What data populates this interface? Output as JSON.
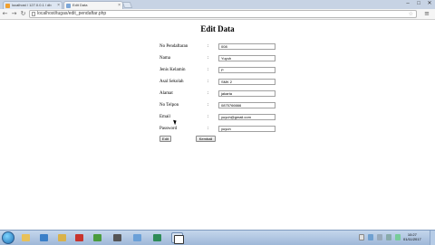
{
  "browser": {
    "tabs": [
      {
        "title": "localhost / 127.0.0.1 / db",
        "favicon": "#f0a030",
        "active": false
      },
      {
        "title": "Edit Data",
        "favicon": "#7da7d8",
        "active": true
      }
    ],
    "address": "localhost/tugas/edit_pendaftar.php",
    "window_controls": [
      "–",
      "□",
      "✕"
    ]
  },
  "page": {
    "title": "Edit Data",
    "fields": [
      {
        "label": "No Pendaftaran",
        "value": "008"
      },
      {
        "label": "Nama",
        "value": "Yuyuh"
      },
      {
        "label": "Jenis Kelamin",
        "value": "P"
      },
      {
        "label": "Asal Sekolah",
        "value": "SMK 2"
      },
      {
        "label": "Alamat",
        "value": "jakarta"
      },
      {
        "label": "No Telpon",
        "value": "0875766666"
      },
      {
        "label": "Email",
        "value": "yuyuh@gmail.com"
      },
      {
        "label": "Password",
        "value": "yuyuh"
      }
    ],
    "colon": ":",
    "buttons": {
      "submit": "Edit",
      "back": "Kembali"
    }
  },
  "taskbar": {
    "apps": [
      {
        "name": "explorer",
        "color": "#e8c15a"
      },
      {
        "name": "media-player",
        "color": "#3a7fc8"
      },
      {
        "name": "file-manager",
        "color": "#d9b24a"
      },
      {
        "name": "pdf-reader",
        "color": "#c8342e"
      },
      {
        "name": "chrome",
        "color": "#4a9c3e"
      },
      {
        "name": "app",
        "color": "#555555"
      },
      {
        "name": "paint",
        "color": "#6aa0d8"
      },
      {
        "name": "tool",
        "color": "#2e8b57"
      },
      {
        "name": "notepad",
        "color": "#ffffff"
      }
    ],
    "clock": {
      "time": "10:27",
      "date": "01/11/2017"
    }
  }
}
